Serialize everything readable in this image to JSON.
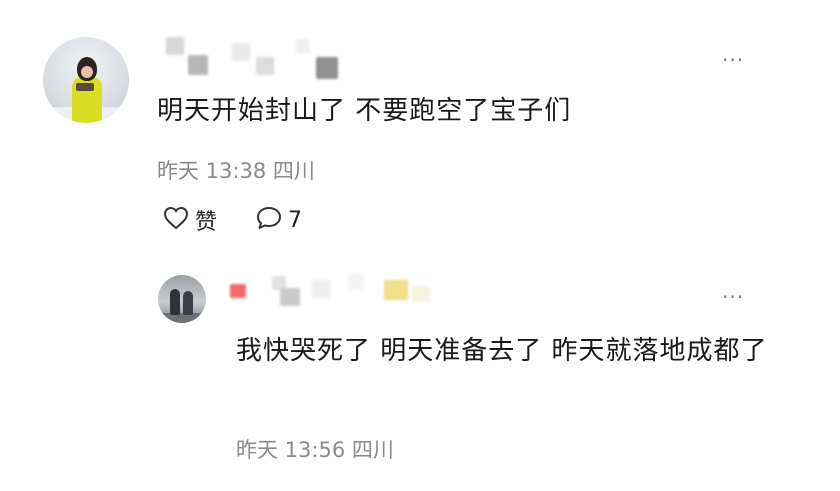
{
  "comment": {
    "author_name_hidden": true,
    "text": "明天开始封山了 不要跑空了宝子们",
    "time": "昨天 13:38",
    "location": "四川",
    "like_label": "赞",
    "reply_count": "7",
    "more_label": "···"
  },
  "reply": {
    "author_name_hidden": true,
    "text": "我快哭死了 明天准备去了 昨天就落地成都了",
    "time": "昨天 13:56",
    "location": "四川",
    "more_label": "···"
  },
  "icons": {
    "like": "heart-outline-icon",
    "reply": "speech-bubble-icon",
    "more": "ellipsis-icon"
  },
  "colors": {
    "text_primary": "#1a1a1a",
    "text_secondary": "#8a8a8a",
    "reply_name_accent": "#f06a6a",
    "reply_name_highlight": "#f3dc8a"
  }
}
